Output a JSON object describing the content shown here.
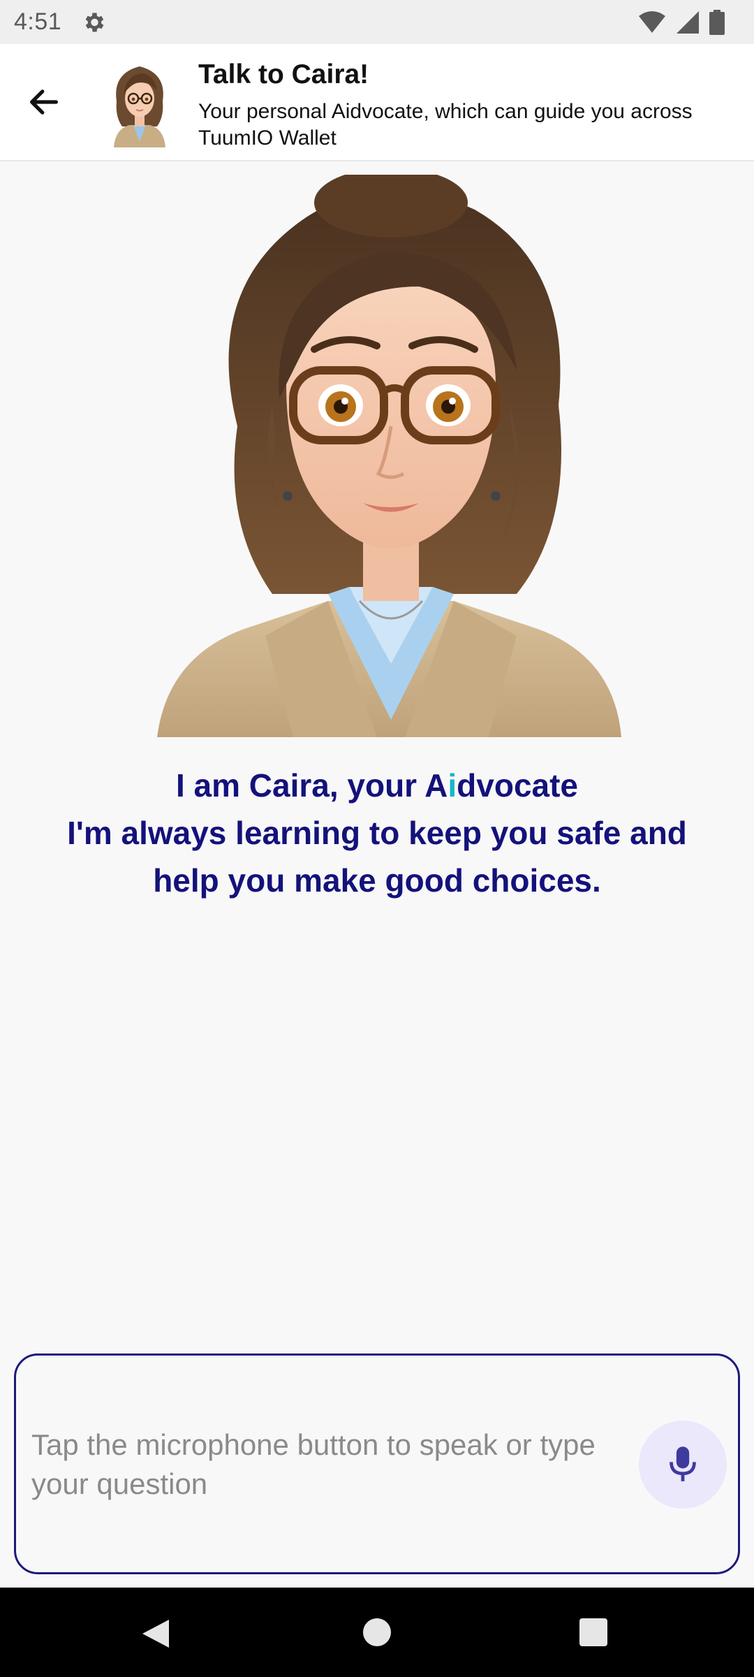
{
  "status": {
    "time": "4:51"
  },
  "header": {
    "title": "Talk to Caira!",
    "subtitle": "Your personal Aidvocate, which can guide you across TuumIO Wallet"
  },
  "intro": {
    "line1_a": "I am Caira, your  A",
    "line1_accent": "i",
    "line1_b": "dvocate",
    "line2": "I'm always learning to keep you safe and",
    "line3": "help you make good choices."
  },
  "input": {
    "placeholder": "Tap the microphone button to speak or type your question"
  },
  "icons": {
    "status_gear": "gear-icon",
    "wifi": "wifi-icon",
    "signal": "signal-icon",
    "battery": "battery-icon",
    "back": "arrow-back-icon",
    "mic": "microphone-icon",
    "nav_back": "nav-back-icon",
    "nav_home": "nav-home-icon",
    "nav_recents": "nav-recents-icon"
  },
  "colors": {
    "accent": "#14127a",
    "highlight": "#18b6c8",
    "mic_bg": "#ebe8fb",
    "mic_fg": "#3f3a9e"
  }
}
